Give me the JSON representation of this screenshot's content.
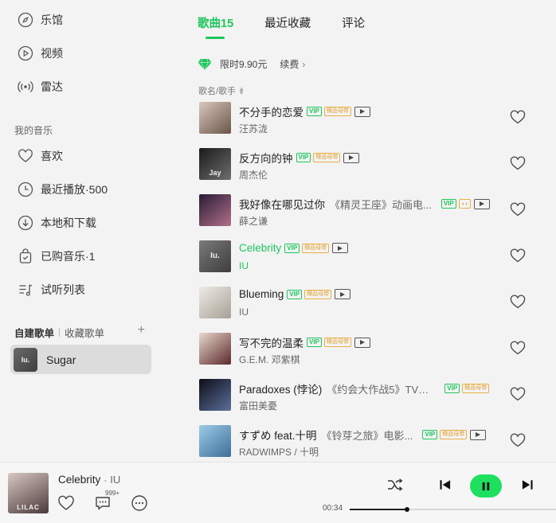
{
  "nav": {
    "hall": "乐馆",
    "video": "视频",
    "radar": "雷达",
    "my_music_label": "我的音乐",
    "like": "喜欢",
    "recent": "最近播放·500",
    "local": "本地和下载",
    "purchased": "已购音乐·1",
    "trial": "试听列表"
  },
  "playlists": {
    "tab_created": "自建歌单",
    "tab_collected": "收藏歌单",
    "add": "+",
    "items": [
      {
        "name": "Sugar",
        "thumb_text": "Iu."
      }
    ]
  },
  "tabs": [
    {
      "label": "歌曲15",
      "active": true
    },
    {
      "label": "最近收藏",
      "active": false
    },
    {
      "label": "评论",
      "active": false
    }
  ],
  "vip": {
    "text": "限时9.90元",
    "renew": "续费",
    "chevron": "›"
  },
  "column_header": "歌名/歌手",
  "badges": {
    "vip": "VIP",
    "hq": "臻品母带"
  },
  "songs": [
    {
      "title": "不分手的恋爱",
      "extra": "",
      "artist": "汪苏泷",
      "badges": [
        "vip",
        "hq",
        "mv"
      ],
      "playing": false,
      "colors": [
        "#d8c8bc",
        "#6b5448"
      ]
    },
    {
      "title": "反方向的钟",
      "extra": "",
      "artist": "周杰伦",
      "badges": [
        "vip",
        "hq",
        "mv"
      ],
      "playing": false,
      "colors": [
        "#1a1a1a",
        "#6e6e6e"
      ],
      "cover_text": "Jay"
    },
    {
      "title": "我好像在哪见过你",
      "extra": "《精灵王座》动画电...",
      "artist": "薛之谦",
      "badges": [
        "vip",
        "dolby",
        "mv"
      ],
      "playing": false,
      "colors": [
        "#2a1b35",
        "#b0708a"
      ]
    },
    {
      "title": "Celebrity",
      "extra": "",
      "artist": "IU",
      "badges": [
        "vip",
        "hq",
        "mv"
      ],
      "playing": true,
      "colors": [
        "#7a7a7a",
        "#3d3d3d"
      ],
      "cover_text": "Iu."
    },
    {
      "title": "Blueming",
      "extra": "",
      "artist": "IU",
      "badges": [
        "vip",
        "hq",
        "mv"
      ],
      "playing": false,
      "colors": [
        "#ecebe6",
        "#a9a095"
      ]
    },
    {
      "title": "写不完的温柔",
      "extra": "",
      "artist": "G.E.M. 邓紫棋",
      "badges": [
        "vip",
        "hq",
        "mv"
      ],
      "playing": false,
      "colors": [
        "#e8d8cc",
        "#5b2a2a"
      ]
    },
    {
      "title": "Paradoxes (悖论)",
      "extra": "《约会大作战5》TV动...",
      "artist": "富田美憂",
      "badges": [
        "vip",
        "hq"
      ],
      "playing": false,
      "colors": [
        "#0e0e18",
        "#5a6f9a"
      ]
    },
    {
      "title": "すずめ feat.十明",
      "extra": "《铃芽之旅》电影...",
      "artist": "RADWIMPS / 十明",
      "badges": [
        "vip",
        "hq",
        "mv"
      ],
      "playing": false,
      "colors": [
        "#9ccbe8",
        "#3e6e96"
      ]
    }
  ],
  "player": {
    "title": "Celebrity",
    "dash": "-",
    "artist": "IU",
    "comment_count": "999+",
    "time": "00:34",
    "progress": 0.27,
    "cover_colors": [
      "#d9c7c2",
      "#4b3a3a"
    ],
    "cover_text": "LILAC"
  },
  "colors": {
    "accent": "#1ec55d",
    "play_button": "#1ee05f"
  }
}
